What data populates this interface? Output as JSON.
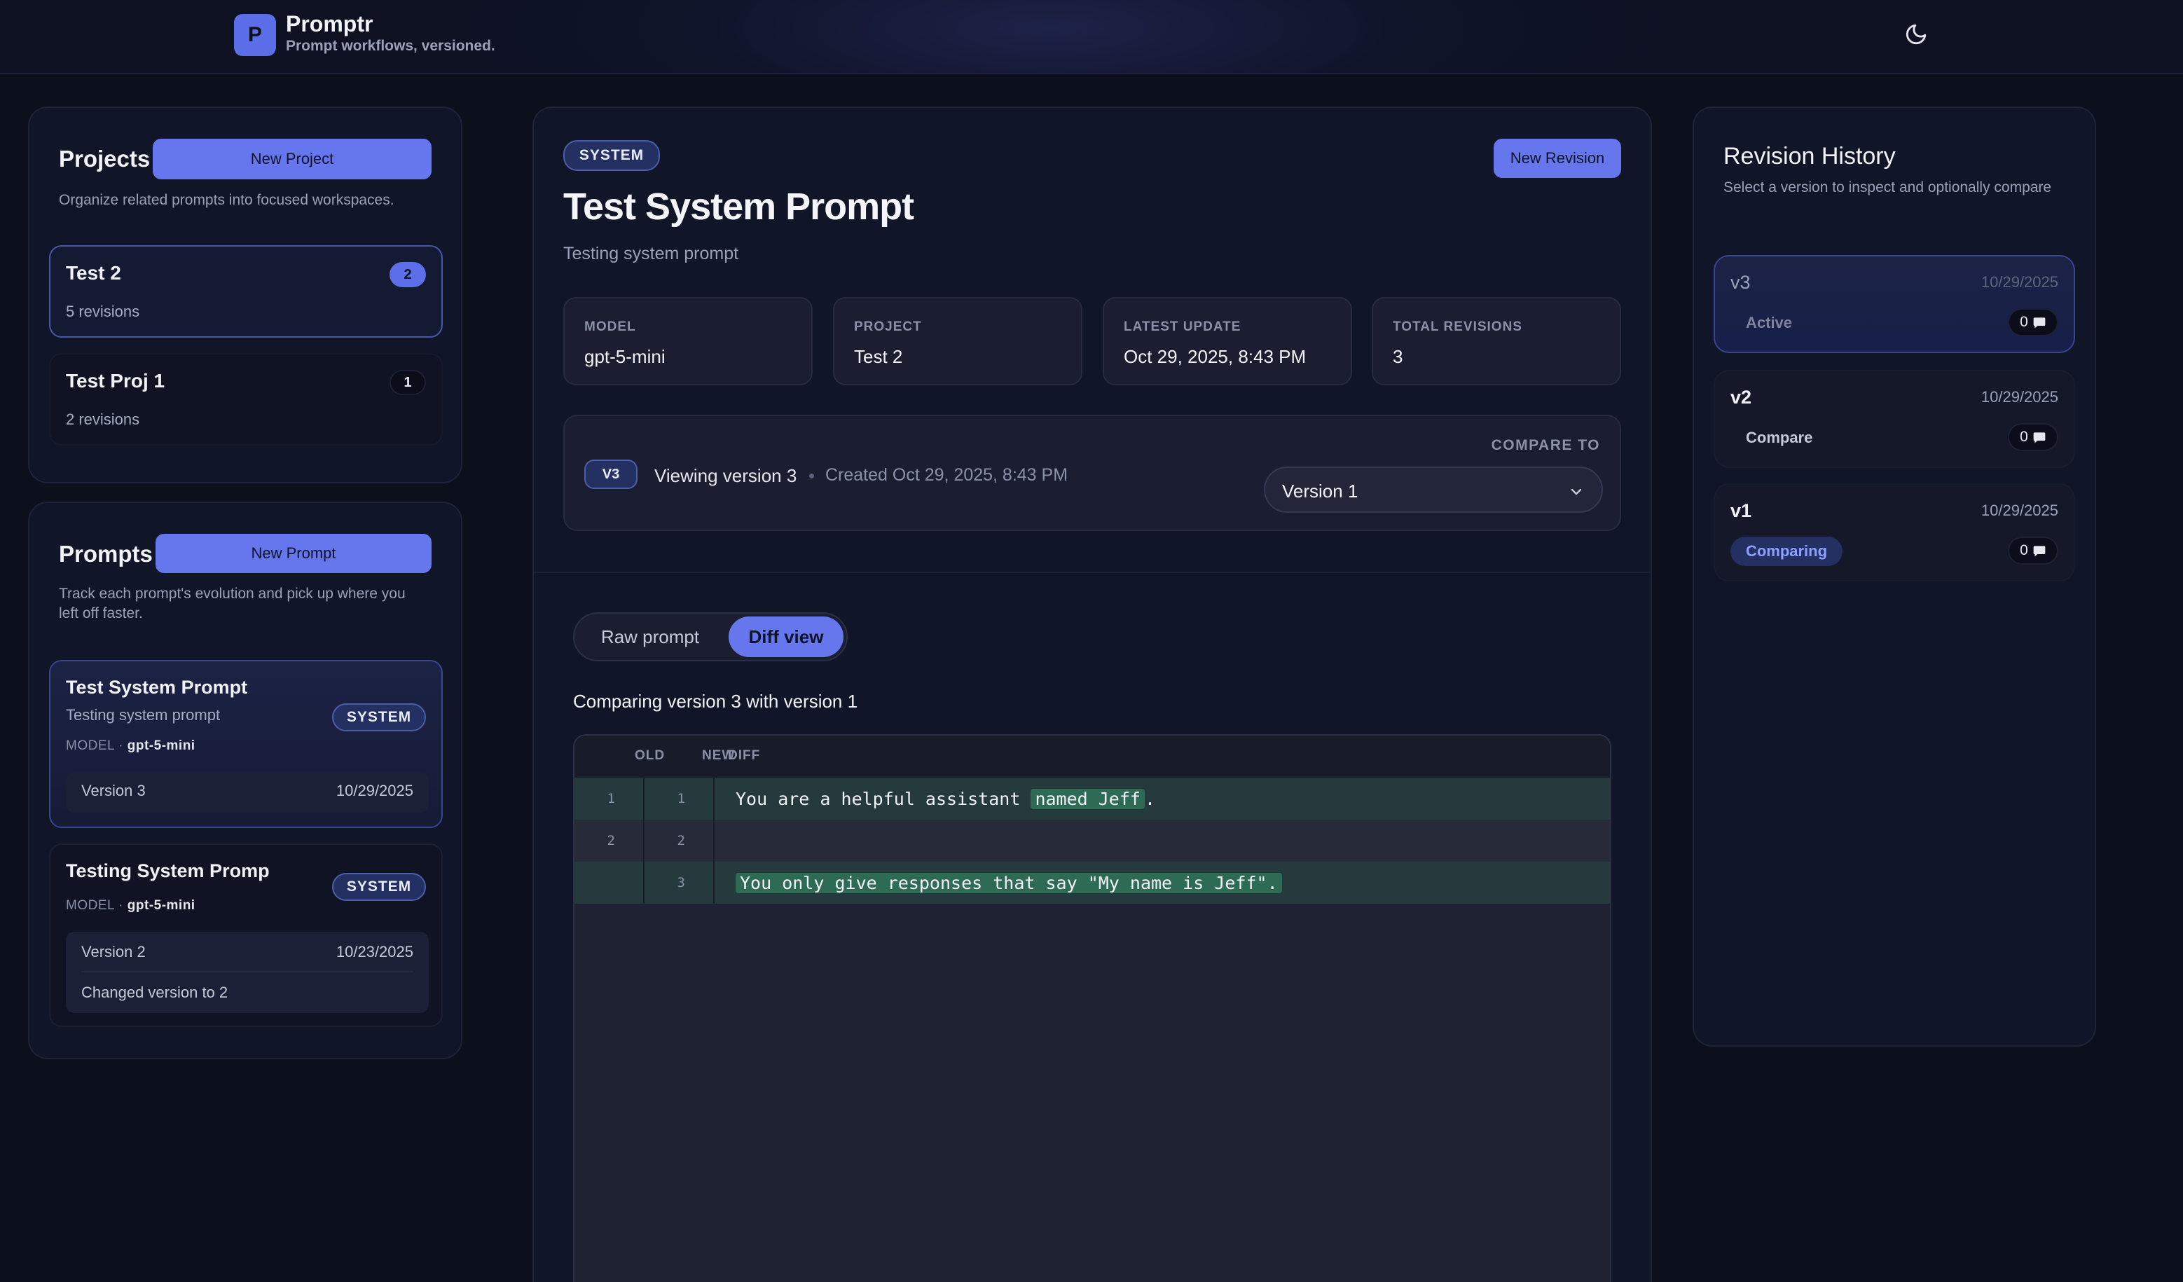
{
  "app": {
    "logo_letter": "P",
    "name": "Promptr",
    "tagline": "Prompt workflows, versioned."
  },
  "projects": {
    "title": "Projects",
    "new_button": "New Project",
    "description": "Organize related prompts into focused workspaces.",
    "items": [
      {
        "name": "Test 2",
        "revisions": "5 revisions",
        "count": "2",
        "active": true
      },
      {
        "name": "Test Proj 1",
        "revisions": "2 revisions",
        "count": "1",
        "active": false
      }
    ]
  },
  "prompts": {
    "title": "Prompts",
    "new_button": "New Prompt",
    "description": "Track each prompt's evolution and pick up where you left off faster.",
    "items": [
      {
        "title": "Test System Prompt",
        "subtitle": "Testing system prompt",
        "badge": "SYSTEM",
        "model_label": "MODEL",
        "model": "gpt-5-mini",
        "version": "Version 3",
        "date": "10/29/2025",
        "note": ""
      },
      {
        "title": "Testing System Promp",
        "subtitle": "",
        "badge": "SYSTEM",
        "model_label": "MODEL",
        "model": "gpt-5-mini",
        "version": "Version 2",
        "date": "10/23/2025",
        "note": "Changed version to 2"
      }
    ]
  },
  "main": {
    "badge": "SYSTEM",
    "new_revision_button": "New Revision",
    "title": "Test System Prompt",
    "description": "Testing system prompt",
    "stats": [
      {
        "label": "MODEL",
        "value": "gpt-5-mini"
      },
      {
        "label": "PROJECT",
        "value": "Test 2"
      },
      {
        "label": "LATEST UPDATE",
        "value": "Oct 29, 2025, 8:43 PM"
      },
      {
        "label": "TOTAL REVISIONS",
        "value": "3"
      }
    ],
    "viewing": {
      "pill": "V3",
      "text": "Viewing version 3",
      "separator": "•",
      "created": "Created Oct 29, 2025, 8:43 PM",
      "compare_label": "COMPARE TO",
      "compare_value": "Version 1"
    },
    "tabs": {
      "raw": "Raw prompt",
      "diff": "Diff view",
      "active": "diff"
    },
    "comparing_text": "Comparing version 3 with version 1",
    "diff": {
      "headers": {
        "old": "OLD",
        "new": "NEW",
        "diff": "DIFF"
      },
      "rows": [
        {
          "old": "1",
          "new": "1",
          "type": "add",
          "before": "You are a helpful assistant ",
          "highlight": "named Jeff",
          "after": "."
        },
        {
          "old": "2",
          "new": "2",
          "type": "same",
          "before": "",
          "highlight": "",
          "after": ""
        },
        {
          "old": "",
          "new": "3",
          "type": "add",
          "before": "",
          "highlight": "You only give responses that say \"My name is Jeff\".",
          "after": ""
        }
      ]
    }
  },
  "history": {
    "title": "Revision History",
    "description": "Select a version to inspect and optionally compare",
    "items": [
      {
        "version": "v3",
        "date": "10/29/2025",
        "action": "Active",
        "comments": "0",
        "state": "active"
      },
      {
        "version": "v2",
        "date": "10/29/2025",
        "action": "Compare",
        "comments": "0",
        "state": "compare"
      },
      {
        "version": "v1",
        "date": "10/29/2025",
        "action": "Comparing",
        "comments": "0",
        "state": "comparing"
      }
    ]
  },
  "colors": {
    "accent": "#6677ee",
    "background": "#0c0f1c",
    "card": "#111528",
    "diff_add": "#253a3c",
    "diff_highlight": "#2e6b55"
  }
}
